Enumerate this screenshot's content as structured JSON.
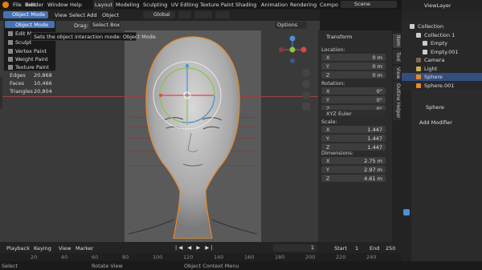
{
  "topbar": {
    "menus": [
      "File",
      "Edit",
      "Render",
      "Window",
      "Help"
    ],
    "workspaces": [
      "Layout",
      "Modeling",
      "Sculpting",
      "UV Editing",
      "Texture Paint",
      "Shading",
      "Animation",
      "Rendering",
      "Compo"
    ],
    "scene_label": "Scene",
    "view_layer_label": "ViewLayer"
  },
  "header": {
    "mode": "Object Mode",
    "menus": [
      "View",
      "Select",
      "Add",
      "Object"
    ],
    "orientation": "Global",
    "options": "Options",
    "drag_label": "Drag:",
    "drag_value": "Select Box"
  },
  "mode_menu": {
    "items": [
      "Object Mode",
      "Edit M",
      "Sculpt",
      "Vertex Paint",
      "Weight Paint",
      "Texture Paint"
    ],
    "tooltip": "Sets the object interaction mode: Object Mode"
  },
  "stats": [
    {
      "label": "Edges",
      "value": "20,868"
    },
    {
      "label": "Faces",
      "value": "10,466"
    },
    {
      "label": "Triangles",
      "value": "20,804"
    }
  ],
  "npanel": {
    "title": "Transform",
    "location_label": "Location:",
    "location": [
      {
        "k": "X",
        "v": "0 m"
      },
      {
        "k": "Y",
        "v": "0 m"
      },
      {
        "k": "Z",
        "v": "0 m"
      }
    ],
    "rotation_label": "Rotation:",
    "rotation": [
      {
        "k": "X",
        "v": "0°"
      },
      {
        "k": "Y",
        "v": "0°"
      },
      {
        "k": "Z",
        "v": "0°"
      }
    ],
    "euler": "XYZ Euler",
    "scale_label": "Scale:",
    "scale": [
      {
        "k": "X",
        "v": "1.447"
      },
      {
        "k": "Y",
        "v": "1.447"
      },
      {
        "k": "Z",
        "v": "1.447"
      }
    ],
    "dimensions_label": "Dimensions:",
    "dimensions": [
      {
        "k": "X",
        "v": "2.75 m"
      },
      {
        "k": "Y",
        "v": "2.97 m"
      },
      {
        "k": "Z",
        "v": "4.61 m"
      }
    ]
  },
  "side_tabs": [
    "Item",
    "Tool",
    "View",
    "Outline Helper"
  ],
  "outliner": {
    "rows": [
      {
        "name": "Collection",
        "indent": 1
      },
      {
        "name": "Collection 1",
        "indent": 2
      },
      {
        "name": "Empty",
        "indent": 3
      },
      {
        "name": "Empty.001",
        "indent": 3
      },
      {
        "name": "Camera",
        "indent": 2
      },
      {
        "name": "Light",
        "indent": 2
      },
      {
        "name": "Sphere",
        "indent": 2,
        "selected": true
      },
      {
        "name": "Sphere.001",
        "indent": 2
      }
    ]
  },
  "properties": {
    "object_name": "Sphere",
    "add_modifier": "Add Modifier"
  },
  "timeline": {
    "menus": [
      "Playback",
      "Keying",
      "View",
      "Marker"
    ],
    "current_frame": "1",
    "start_label": "Start",
    "start_value": "1",
    "end_label": "End",
    "end_value": "250",
    "ruler": [
      "20",
      "40",
      "60",
      "80",
      "100",
      "120",
      "140",
      "160",
      "180",
      "200",
      "220",
      "240"
    ]
  },
  "status": {
    "select": "Select",
    "rotate": "Rotate View",
    "context": "Object Context Menu"
  },
  "colors": {
    "accent": "#4772b3",
    "selection_orange": "#e8892b",
    "gizmo_x": "#e0434e",
    "gizmo_y": "#8bc34a",
    "gizmo_z": "#4a8fd8"
  }
}
